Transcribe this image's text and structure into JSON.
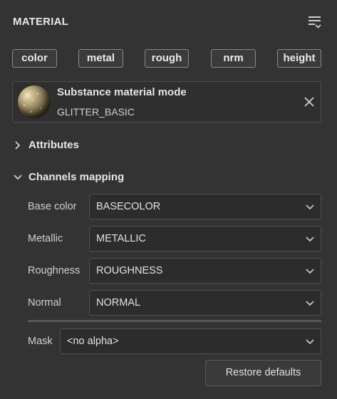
{
  "panel": {
    "title": "MATERIAL",
    "menu_icon": "list-menu-icon"
  },
  "tags": [
    {
      "label": "color"
    },
    {
      "label": "metal"
    },
    {
      "label": "rough"
    },
    {
      "label": "nrm"
    },
    {
      "label": "height"
    }
  ],
  "material": {
    "mode_label": "Substance material mode",
    "name": "GLITTER_BASIC",
    "close_icon": "close-icon"
  },
  "sections": {
    "attributes": {
      "label": "Attributes",
      "expanded": false
    },
    "channels": {
      "label": "Channels mapping",
      "expanded": true
    }
  },
  "channels": [
    {
      "label": "Base color",
      "value": "BASECOLOR"
    },
    {
      "label": "Metallic",
      "value": "METALLIC"
    },
    {
      "label": "Roughness",
      "value": "ROUGHNESS"
    },
    {
      "label": "Normal",
      "value": "NORMAL"
    }
  ],
  "mask": {
    "label": "Mask",
    "value": "<no alpha>"
  },
  "restore_button": {
    "label": "Restore defaults"
  },
  "colors": {
    "background": "#333333",
    "field_bg": "#2c2c2c",
    "text": "#d6d6d6"
  }
}
